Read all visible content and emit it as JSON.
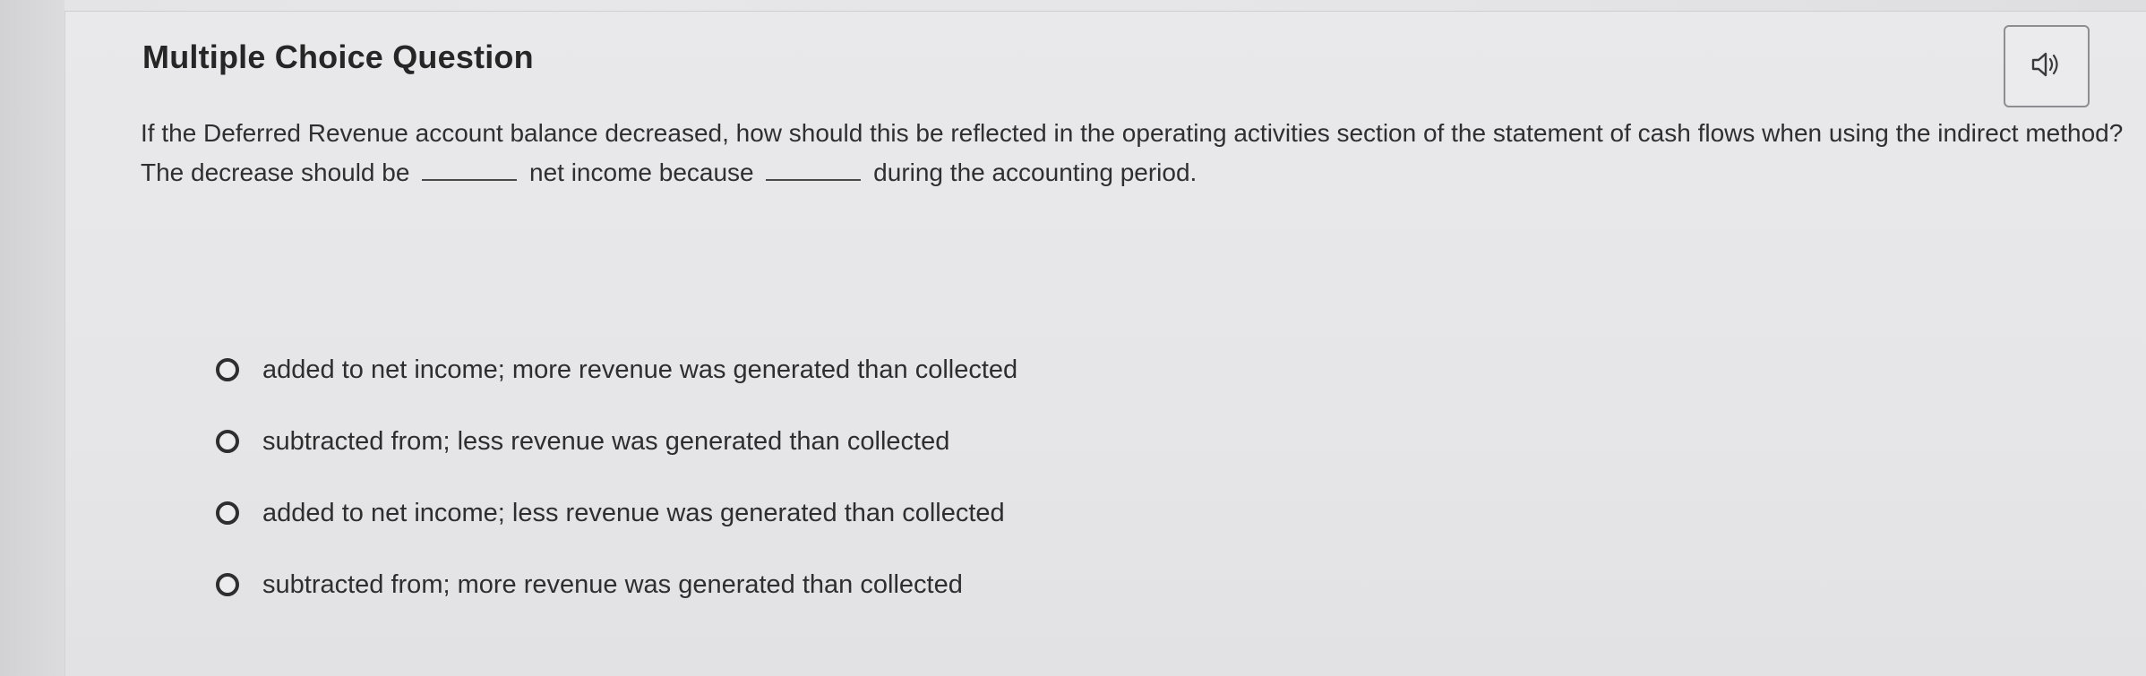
{
  "header": {
    "title": "Multiple Choice Question",
    "audio_icon": "speaker-icon"
  },
  "question": {
    "part1": "If the Deferred Revenue account balance decreased, how should this be reflected in the operating activities section of the statement of cash flows when using the indirect method? The decrease should be",
    "part2": "net income because",
    "part3": "during the accounting period."
  },
  "options": [
    {
      "label": "added to net income; more revenue was generated than collected",
      "selected": false
    },
    {
      "label": "subtracted from; less revenue was generated than collected",
      "selected": false
    },
    {
      "label": "added to net income; less revenue was generated than collected",
      "selected": false
    },
    {
      "label": "subtracted from; more revenue was generated than collected",
      "selected": false
    }
  ]
}
